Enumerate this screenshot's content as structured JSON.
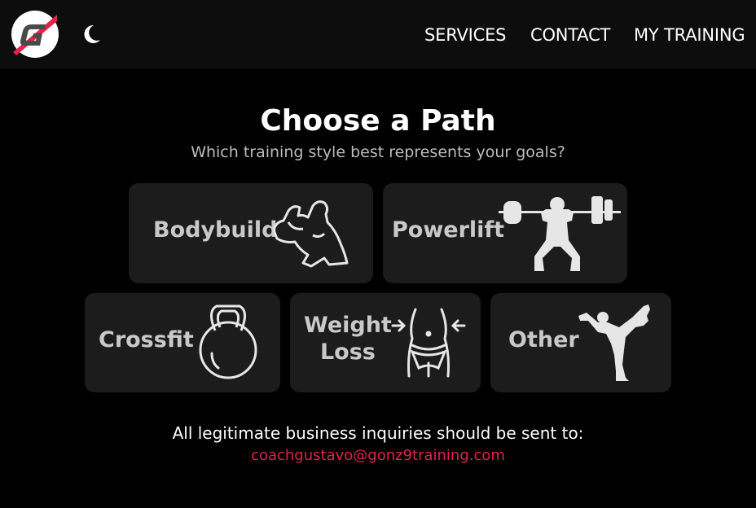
{
  "header": {
    "logo_icon": "g-logo-icon",
    "theme_toggle_icon": "moon-icon",
    "nav": {
      "services": "SERVICES",
      "contact": "CONTACT",
      "my_training": "MY TRAINING"
    }
  },
  "main": {
    "title": "Choose a Path",
    "subtitle": "Which training style best represents your goals?",
    "paths": [
      {
        "label": "Bodybuild",
        "icon": "flexing-bodybuilder-icon"
      },
      {
        "label": "Powerlift",
        "icon": "weightlifter-icon"
      },
      {
        "label": "Crossfit",
        "icon": "kettlebell-icon"
      },
      {
        "label_line1": "Weight",
        "label_line2": "Loss",
        "icon": "waist-slimming-icon"
      },
      {
        "label": "Other",
        "icon": "yoga-pose-icon"
      }
    ]
  },
  "footer": {
    "text": "All legitimate business inquiries should be sent to:",
    "email": "coachgustavo@gonz9training.com"
  },
  "colors": {
    "background": "#000000",
    "header_bg": "#0d0d0d",
    "card_bg": "#1c1c1c",
    "accent": "#e0244a"
  }
}
